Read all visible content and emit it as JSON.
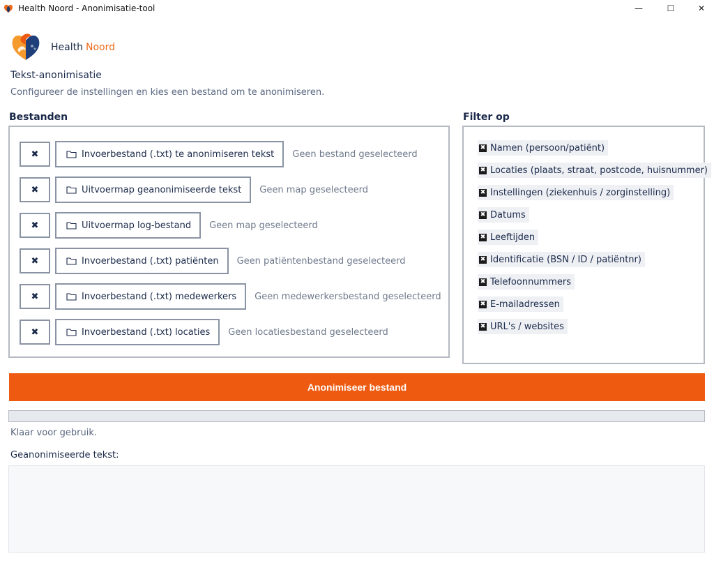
{
  "window": {
    "title": "Health Noord - Anonimisatie-tool",
    "controls": {
      "minimize": "—",
      "maximize": "☐",
      "close": "✕"
    }
  },
  "brand": {
    "part1": "Health",
    "part2": "Noord"
  },
  "header": {
    "title": "Tekst-anonimisatie",
    "subtitle": "Configureer de instellingen en kies een bestand om te anonimiseren."
  },
  "files": {
    "label": "Bestanden",
    "clear_glyph": "✖",
    "rows": [
      {
        "button": "Invoerbestand (.txt) te anonimiseren tekst",
        "status": "Geen bestand geselecteerd"
      },
      {
        "button": "Uitvoermap geanonimiseerde tekst",
        "status": "Geen map geselecteerd"
      },
      {
        "button": "Uitvoermap log-bestand",
        "status": "Geen map geselecteerd"
      },
      {
        "button": "Invoerbestand (.txt) patiënten",
        "status": "Geen patiëntenbestand geselecteerd"
      },
      {
        "button": "Invoerbestand (.txt) medewerkers",
        "status": "Geen medewerkersbestand geselecteerd"
      },
      {
        "button": "Invoerbestand (.txt) locaties",
        "status": "Geen locatiesbestand geselecteerd"
      }
    ]
  },
  "filter": {
    "label": "Filter op",
    "check_glyph": "✖",
    "items": [
      {
        "label": "Namen (persoon/patiënt)",
        "checked": true
      },
      {
        "label": "Locaties (plaats, straat, postcode, huisnummer)",
        "checked": true
      },
      {
        "label": "Instellingen (ziekenhuis / zorginstelling)",
        "checked": true
      },
      {
        "label": "Datums",
        "checked": true
      },
      {
        "label": "Leeftijden",
        "checked": true
      },
      {
        "label": "Identificatie (BSN / ID / patiëntnr)",
        "checked": true
      },
      {
        "label": "Telefoonnummers",
        "checked": true
      },
      {
        "label": "E-mailadressen",
        "checked": true
      },
      {
        "label": "URL's / websites",
        "checked": true
      }
    ]
  },
  "action": {
    "label": "Anonimiseer bestand"
  },
  "progress": {
    "value": 0
  },
  "status": {
    "text": "Klaar voor gebruik."
  },
  "output": {
    "label": "Geanonimiseerde tekst:",
    "value": ""
  },
  "icons": {
    "app": "heart-logo-icon",
    "folder": "folder-icon",
    "clear": "clear-icon",
    "check": "checkbox-checked-icon"
  },
  "colors": {
    "accent": "#ee5a0f",
    "brand_orange": "#ee6b1c",
    "text_dark": "#1b2a4a",
    "text_muted": "#6f7a8c",
    "border": "#b5bac2"
  }
}
